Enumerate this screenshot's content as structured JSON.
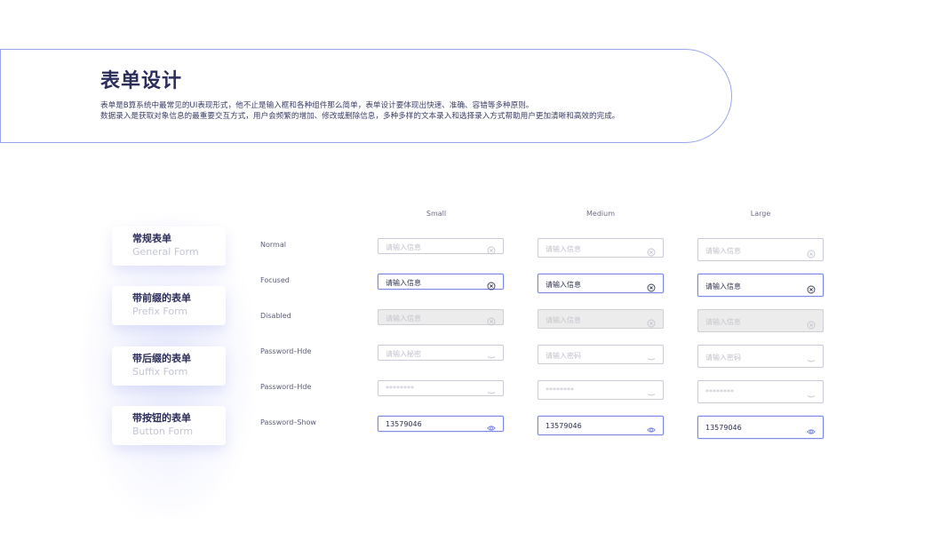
{
  "header": {
    "title": "表单设计",
    "desc_line1": "表单是B算系统中最常见的UI表现形式，他不止是输入框和各种组件那么简单，表单设计要体现出快速、准确、容错等多种原则。",
    "desc_line2": "数据录入是获取对象信息的最重要交互方式，用户会频繁的增加、修改或删除信息，多种多样的文本录入和选择录入方式帮助用户更加清晰和高效的完成。"
  },
  "cards": [
    {
      "cn": "常规表单",
      "en": "General Form"
    },
    {
      "cn": "带前缀的表单",
      "en": "Prefix Form"
    },
    {
      "cn": "带后缀的表单",
      "en": "Suffix Form"
    },
    {
      "cn": "带按钮的表单",
      "en": "Button Form"
    }
  ],
  "columns": [
    "Small",
    "Medium",
    "Large"
  ],
  "rows": [
    {
      "label": "Normal",
      "state": "normal",
      "icon": "clear-icon",
      "values": [
        "请输入信息",
        "请输入信息",
        "请输入信息"
      ]
    },
    {
      "label": "Focused",
      "state": "focused",
      "icon": "clear-icon",
      "values": [
        "请输入信息",
        "请输入信息",
        "请输入信息"
      ]
    },
    {
      "label": "Disabled",
      "state": "disabled",
      "icon": "clear-icon",
      "values": [
        "请输入信息",
        "请输入信息",
        "请输入信息"
      ]
    },
    {
      "label": "Password–Hde",
      "state": "normal",
      "icon": "eye-closed-icon",
      "values": [
        "请输入秘密",
        "请输入密码",
        "请输入密码"
      ]
    },
    {
      "label": "Password–Hde",
      "state": "normal",
      "icon": "eye-closed-icon",
      "values": [
        "********",
        "********",
        "********"
      ]
    },
    {
      "label": "Password–Show",
      "state": "show",
      "icon": "eye-open-icon",
      "values": [
        "13579046",
        "13579046",
        "13579046"
      ]
    }
  ],
  "colors": {
    "accent": "#7b8ae8",
    "title": "#2b2d5a",
    "placeholder": "#c0c2cc",
    "disabled_bg": "#ececec"
  }
}
